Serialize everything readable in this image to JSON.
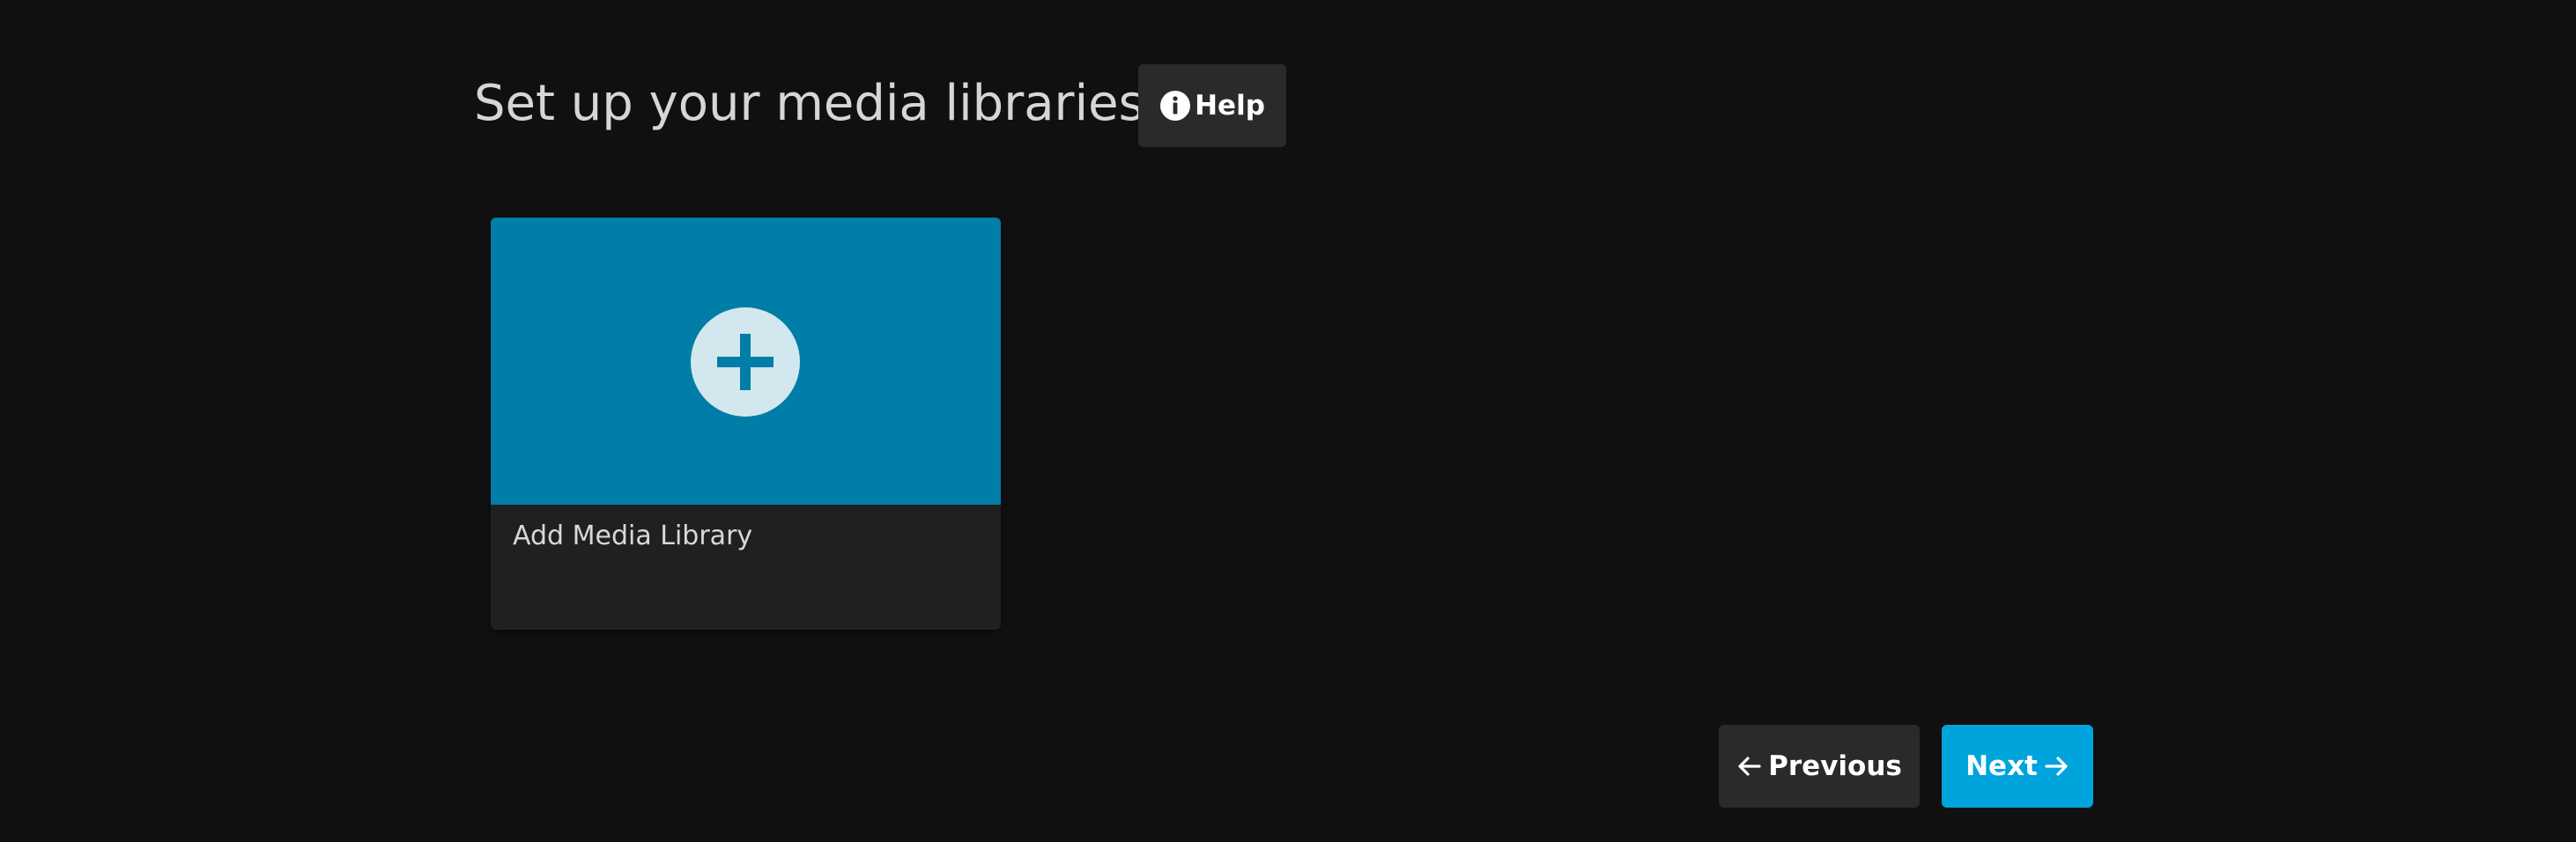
{
  "page": {
    "title": "Set up your media libraries"
  },
  "help": {
    "label": "Help",
    "icon": "info-icon"
  },
  "library_card": {
    "label": "Add Media Library",
    "icon": "add-icon",
    "image_color": "#007ea8"
  },
  "navigation": {
    "previous_label": "Previous",
    "previous_icon": "arrow-left-icon",
    "next_label": "Next",
    "next_icon": "arrow-right-icon"
  },
  "colors": {
    "background": "#101010",
    "accent": "#00a4dc",
    "button_secondary": "#2a2a2a"
  }
}
